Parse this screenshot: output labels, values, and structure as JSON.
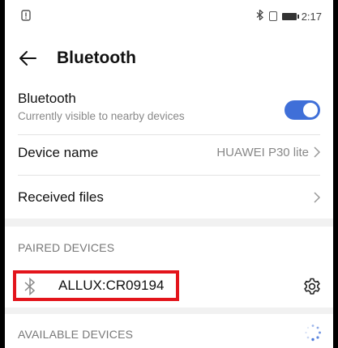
{
  "status_bar": {
    "notification_icon": "alert-notification-icon",
    "bluetooth_icon": "bluetooth-status-icon",
    "vibrate_icon": "vibrate-icon",
    "battery_icon": "battery-icon",
    "time": "2:17"
  },
  "app_bar": {
    "title": "Bluetooth",
    "back_icon": "back-arrow-icon"
  },
  "bluetooth_setting": {
    "label": "Bluetooth",
    "subtitle": "Currently visible to nearby devices",
    "enabled": true,
    "accent_color": "#3f6fd8"
  },
  "device_name_setting": {
    "label": "Device name",
    "value": "HUAWEI P30 lite"
  },
  "received_files_setting": {
    "label": "Received files"
  },
  "paired_devices": {
    "header": "PAIRED DEVICES",
    "devices": [
      {
        "name": "ALLUX:CR09194",
        "icon": "bluetooth-icon",
        "settings_icon": "gear-icon"
      }
    ],
    "highlight_color": "#e3141b"
  },
  "available_devices": {
    "header": "AVAILABLE DEVICES",
    "scanning_icon": "loading-spinner-icon"
  }
}
